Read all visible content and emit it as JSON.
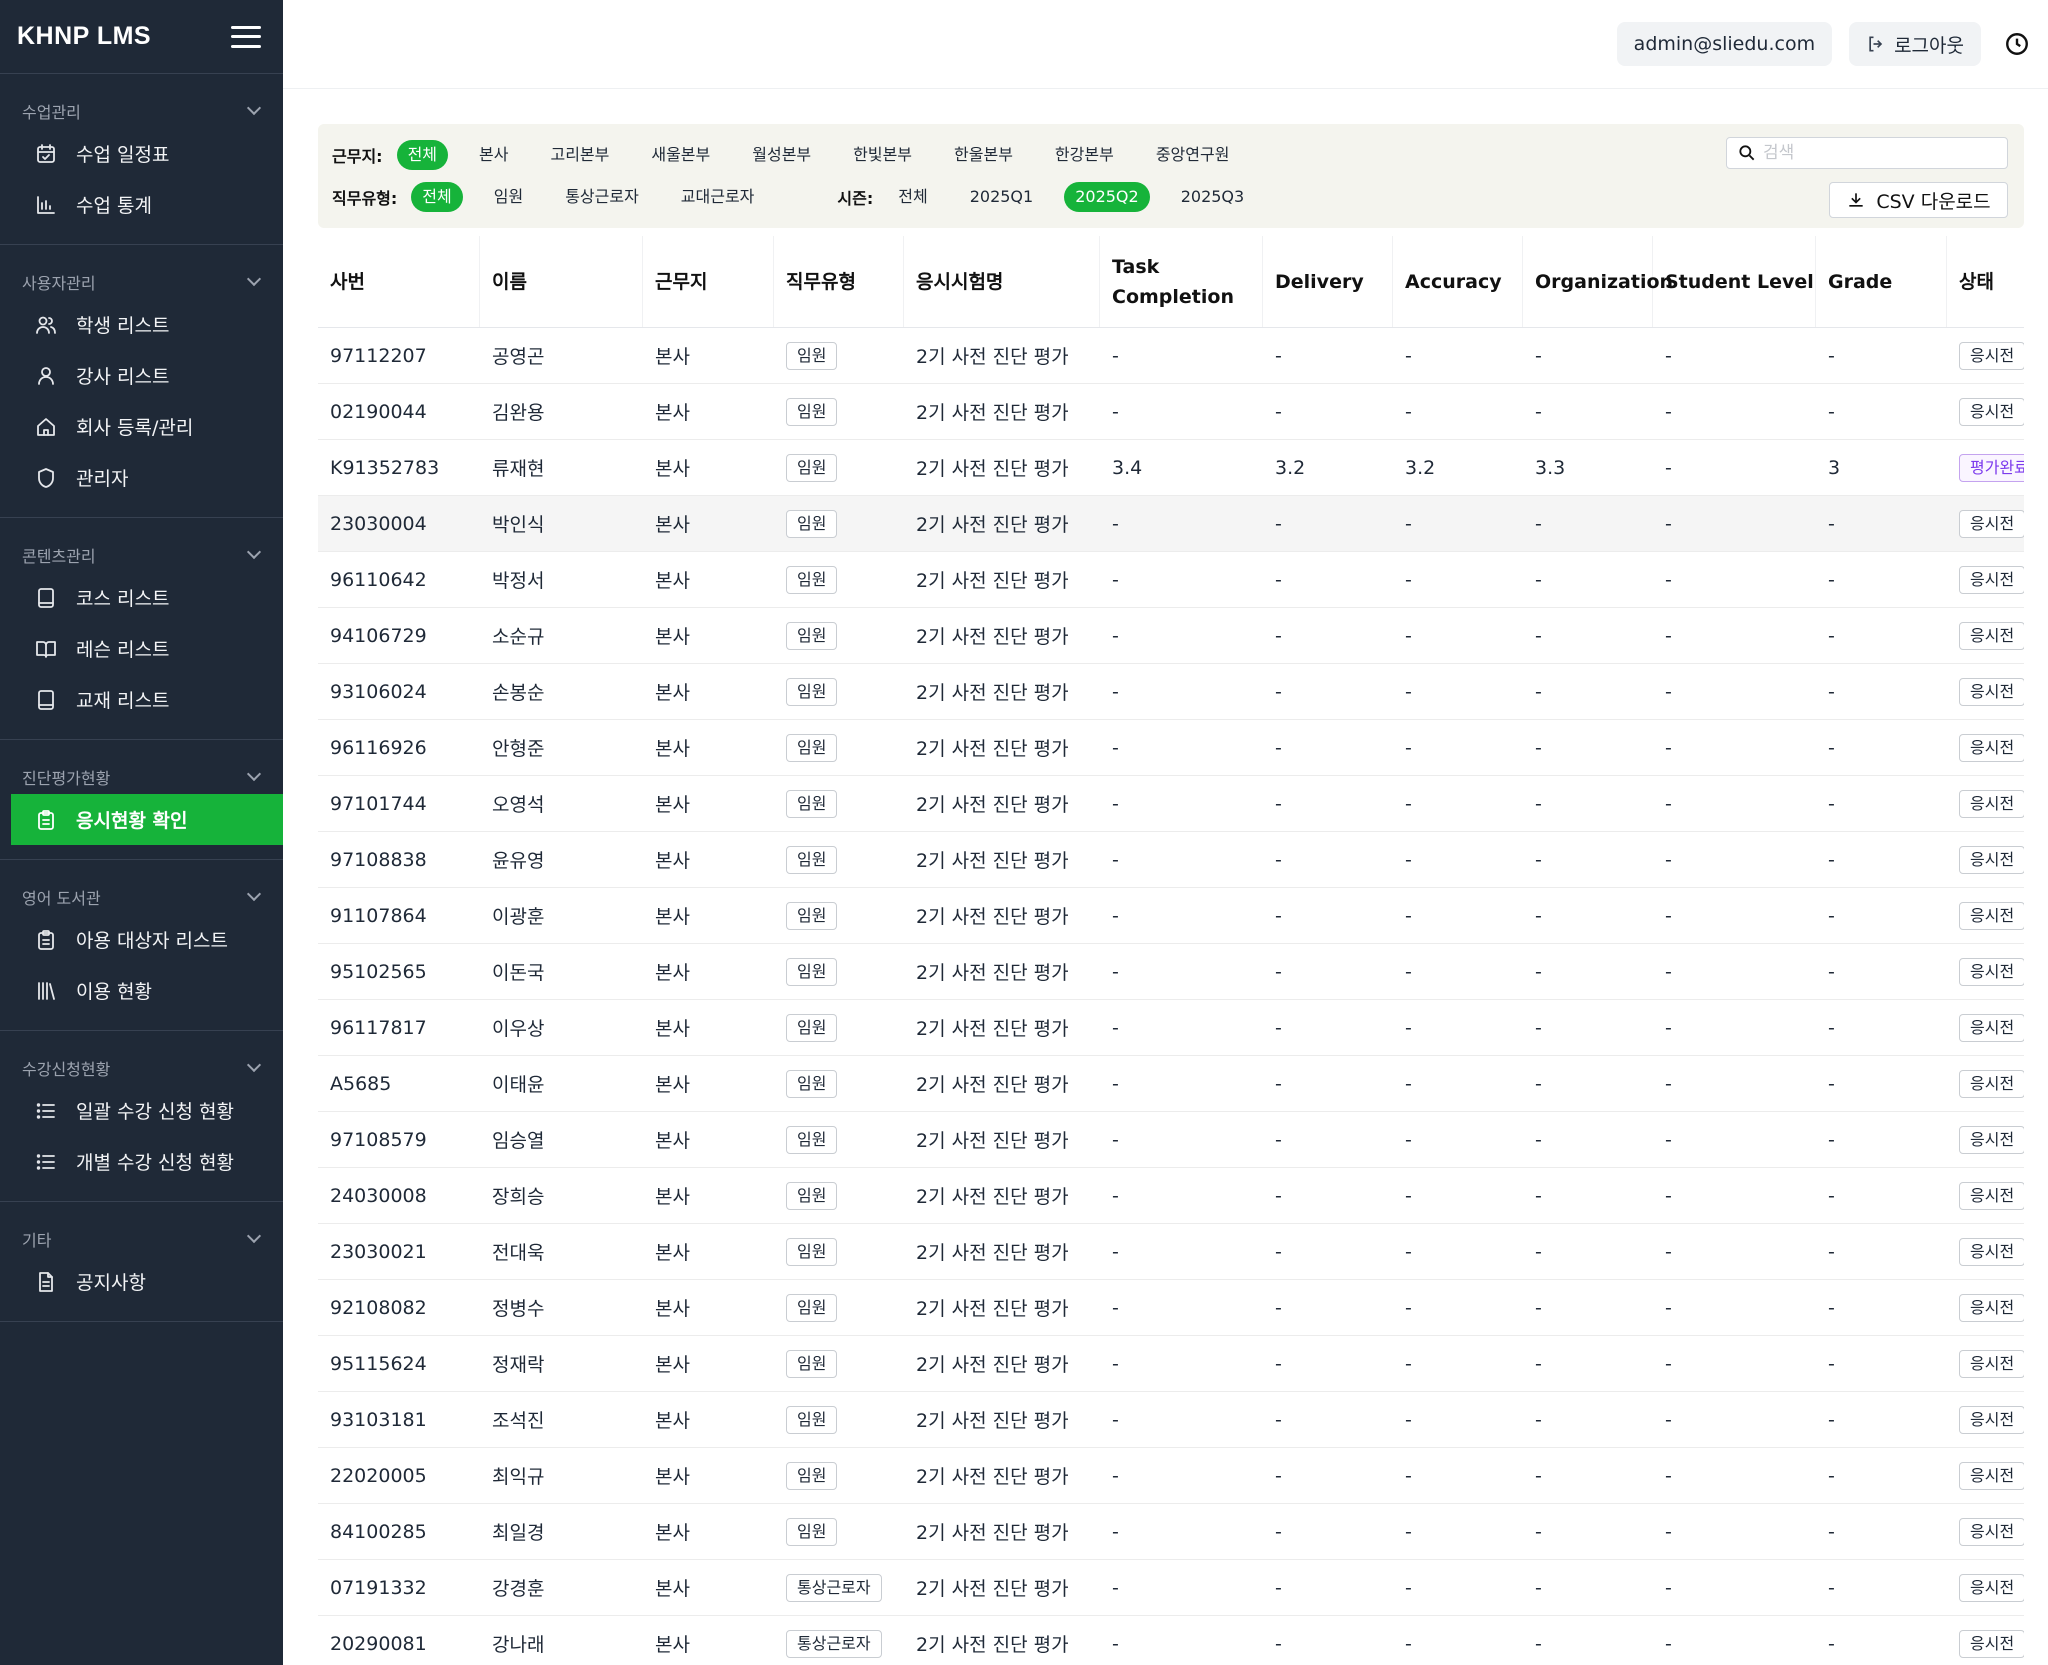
{
  "brand": "KHNP LMS",
  "sidebar": {
    "sections": [
      {
        "title": "수업관리",
        "items": [
          {
            "label": "수업 일정표",
            "icon": "calendar-check-icon"
          },
          {
            "label": "수업 통계",
            "icon": "bar-chart-icon"
          }
        ]
      },
      {
        "title": "사용자관리",
        "items": [
          {
            "label": "학생 리스트",
            "icon": "users-icon"
          },
          {
            "label": "강사 리스트",
            "icon": "user-icon"
          },
          {
            "label": "회사 등록/관리",
            "icon": "home-icon"
          },
          {
            "label": "관리자",
            "icon": "shield-icon"
          }
        ]
      },
      {
        "title": "콘텐츠관리",
        "items": [
          {
            "label": "코스 리스트",
            "icon": "book-icon"
          },
          {
            "label": "레슨 리스트",
            "icon": "book-open-icon"
          },
          {
            "label": "교재 리스트",
            "icon": "book-icon"
          }
        ]
      },
      {
        "title": "진단평가현황",
        "items": [
          {
            "label": "응시현황 확인",
            "icon": "clipboard-icon",
            "active": true
          }
        ]
      },
      {
        "title": "영어 도서관",
        "items": [
          {
            "label": "아용 대상자 리스트",
            "icon": "clipboard-icon"
          },
          {
            "label": "이용 현황",
            "icon": "library-icon"
          }
        ]
      },
      {
        "title": "수강신청현황",
        "items": [
          {
            "label": "일괄 수강 신청 현황",
            "icon": "list-icon"
          },
          {
            "label": "개별 수강 신청 현황",
            "icon": "list-icon"
          }
        ]
      },
      {
        "title": "기타",
        "items": [
          {
            "label": "공지사항",
            "icon": "document-icon"
          }
        ]
      }
    ]
  },
  "topbar": {
    "email": "admin@sliedu.com",
    "logout": "로그아웃"
  },
  "filters": {
    "workplace_label": "근무지:",
    "workplaces": [
      "전체",
      "본사",
      "고리본부",
      "새울본부",
      "월성본부",
      "한빛본부",
      "한울본부",
      "한강본부",
      "중앙연구원"
    ],
    "workplace_selected": 0,
    "jobtype_label": "직무유형:",
    "jobtypes": [
      "전체",
      "임원",
      "통상근로자",
      "교대근로자"
    ],
    "jobtype_selected": 0,
    "season_label": "시즌:",
    "seasons": [
      "전체",
      "2025Q1",
      "2025Q2",
      "2025Q3"
    ],
    "season_selected": 2,
    "search_placeholder": "검색",
    "csv_label": "CSV 다운로드"
  },
  "table": {
    "columns": [
      "사번",
      "이름",
      "근무지",
      "직무유형",
      "응시시험명",
      "Task Completion",
      "Delivery",
      "Accuracy",
      "Organization",
      "Student Level",
      "Grade",
      "상태"
    ],
    "rows": [
      [
        "97112207",
        "공영곤",
        "본사",
        "임원",
        "2기 사전 진단 평가",
        "-",
        "-",
        "-",
        "-",
        "-",
        "-",
        "응시전"
      ],
      [
        "02190044",
        "김완용",
        "본사",
        "임원",
        "2기 사전 진단 평가",
        "-",
        "-",
        "-",
        "-",
        "-",
        "-",
        "응시전"
      ],
      [
        "K91352783",
        "류재현",
        "본사",
        "임원",
        "2기 사전 진단 평가",
        "3.4",
        "3.2",
        "3.2",
        "3.3",
        "-",
        "3",
        "평가완료"
      ],
      [
        "23030004",
        "박인식",
        "본사",
        "임원",
        "2기 사전 진단 평가",
        "-",
        "-",
        "-",
        "-",
        "-",
        "-",
        "응시전"
      ],
      [
        "96110642",
        "박정서",
        "본사",
        "임원",
        "2기 사전 진단 평가",
        "-",
        "-",
        "-",
        "-",
        "-",
        "-",
        "응시전"
      ],
      [
        "94106729",
        "소순규",
        "본사",
        "임원",
        "2기 사전 진단 평가",
        "-",
        "-",
        "-",
        "-",
        "-",
        "-",
        "응시전"
      ],
      [
        "93106024",
        "손봉순",
        "본사",
        "임원",
        "2기 사전 진단 평가",
        "-",
        "-",
        "-",
        "-",
        "-",
        "-",
        "응시전"
      ],
      [
        "96116926",
        "안형준",
        "본사",
        "임원",
        "2기 사전 진단 평가",
        "-",
        "-",
        "-",
        "-",
        "-",
        "-",
        "응시전"
      ],
      [
        "97101744",
        "오영석",
        "본사",
        "임원",
        "2기 사전 진단 평가",
        "-",
        "-",
        "-",
        "-",
        "-",
        "-",
        "응시전"
      ],
      [
        "97108838",
        "윤유영",
        "본사",
        "임원",
        "2기 사전 진단 평가",
        "-",
        "-",
        "-",
        "-",
        "-",
        "-",
        "응시전"
      ],
      [
        "91107864",
        "이광훈",
        "본사",
        "임원",
        "2기 사전 진단 평가",
        "-",
        "-",
        "-",
        "-",
        "-",
        "-",
        "응시전"
      ],
      [
        "95102565",
        "이돈국",
        "본사",
        "임원",
        "2기 사전 진단 평가",
        "-",
        "-",
        "-",
        "-",
        "-",
        "-",
        "응시전"
      ],
      [
        "96117817",
        "이우상",
        "본사",
        "임원",
        "2기 사전 진단 평가",
        "-",
        "-",
        "-",
        "-",
        "-",
        "-",
        "응시전"
      ],
      [
        "A5685",
        "이태윤",
        "본사",
        "임원",
        "2기 사전 진단 평가",
        "-",
        "-",
        "-",
        "-",
        "-",
        "-",
        "응시전"
      ],
      [
        "97108579",
        "임승열",
        "본사",
        "임원",
        "2기 사전 진단 평가",
        "-",
        "-",
        "-",
        "-",
        "-",
        "-",
        "응시전"
      ],
      [
        "24030008",
        "장희승",
        "본사",
        "임원",
        "2기 사전 진단 평가",
        "-",
        "-",
        "-",
        "-",
        "-",
        "-",
        "응시전"
      ],
      [
        "23030021",
        "전대욱",
        "본사",
        "임원",
        "2기 사전 진단 평가",
        "-",
        "-",
        "-",
        "-",
        "-",
        "-",
        "응시전"
      ],
      [
        "92108082",
        "정병수",
        "본사",
        "임원",
        "2기 사전 진단 평가",
        "-",
        "-",
        "-",
        "-",
        "-",
        "-",
        "응시전"
      ],
      [
        "95115624",
        "정재락",
        "본사",
        "임원",
        "2기 사전 진단 평가",
        "-",
        "-",
        "-",
        "-",
        "-",
        "-",
        "응시전"
      ],
      [
        "93103181",
        "조석진",
        "본사",
        "임원",
        "2기 사전 진단 평가",
        "-",
        "-",
        "-",
        "-",
        "-",
        "-",
        "응시전"
      ],
      [
        "22020005",
        "최익규",
        "본사",
        "임원",
        "2기 사전 진단 평가",
        "-",
        "-",
        "-",
        "-",
        "-",
        "-",
        "응시전"
      ],
      [
        "84100285",
        "최일경",
        "본사",
        "임원",
        "2기 사전 진단 평가",
        "-",
        "-",
        "-",
        "-",
        "-",
        "-",
        "응시전"
      ],
      [
        "07191332",
        "강경훈",
        "본사",
        "통상근로자",
        "2기 사전 진단 평가",
        "-",
        "-",
        "-",
        "-",
        "-",
        "-",
        "응시전"
      ],
      [
        "20290081",
        "강나래",
        "본사",
        "통상근로자",
        "2기 사전 진단 평가",
        "-",
        "-",
        "-",
        "-",
        "-",
        "-",
        "응시전"
      ]
    ],
    "highlighted_row": 3
  },
  "colors": {
    "sidebar_bg": "#1f2937",
    "accent": "#16b33a",
    "status_done": "#7c3aed"
  }
}
